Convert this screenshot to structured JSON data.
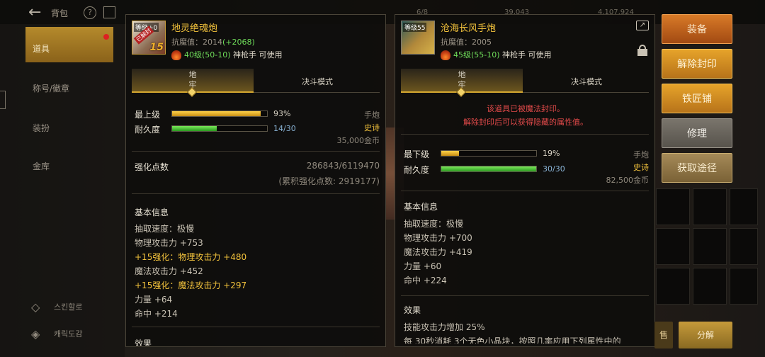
{
  "topbar": {
    "title": "背包",
    "help": "?",
    "nums": [
      "6/8",
      "39,043",
      "4,107,924"
    ]
  },
  "leftnav": {
    "items": [
      "道具",
      "称号/徽章",
      "装扮",
      "金库"
    ],
    "bottom": [
      "스킨할로",
      "캐릭도감"
    ]
  },
  "colors": {
    "gold": "#f2c23c",
    "green": "#6fdc5a",
    "red": "#e24a4a",
    "accent_orange": "#d87a28"
  },
  "panel1": {
    "icon_tag": "等级+0",
    "icon_seal": "已解封",
    "icon_level": "15",
    "name": "地灵绝魂炮",
    "resistance_label": "抗魔值：2014",
    "resistance_bonus": "(+2068)",
    "req_level": "40级(50-10)",
    "req_class": "神枪手 可使用",
    "tab_active": "地牢",
    "tab_inactive": "决斗模式",
    "stat1_label": "最上级",
    "stat1_value": "93%",
    "stat1_fill": 0.93,
    "stat2_label": "耐久度",
    "stat2_value": "14/30",
    "stat2_fill": 0.47,
    "weapon_type": "手炮",
    "rarity": "史诗",
    "price": "35,000金币",
    "reinforce_label": "强化点数",
    "reinforce_value": "286843/6119470",
    "reinforce_total": "(累积强化点数: 2919177)",
    "basic_info_title": "基本信息",
    "lines": [
      {
        "text": "抽取速度：极慢",
        "gold": false
      },
      {
        "text": "物理攻击力 +753",
        "gold": false
      },
      {
        "text": "+15强化：物理攻击力 +480",
        "gold": true
      },
      {
        "text": "魔法攻击力 +452",
        "gold": false
      },
      {
        "text": "+15强化：魔法攻击力 +297",
        "gold": true
      },
      {
        "text": "力量 +64",
        "gold": false
      },
      {
        "text": "命中 +214",
        "gold": false
      }
    ],
    "cut_title": "效果"
  },
  "panel2": {
    "icon_tag": "等级55",
    "name": "沧海长风手炮",
    "resistance_label": "抗魔值：2005",
    "req_level": "45级(55-10)",
    "req_class": "神枪手 可使用",
    "tab_active": "地牢",
    "tab_inactive": "决斗模式",
    "seal_notice_1": "该道具已被魔法封印。",
    "seal_notice_2": "解除封印后可以获得隐藏的属性值。",
    "stat1_label": "最下级",
    "stat1_value": "19%",
    "stat1_fill": 0.19,
    "stat2_label": "耐久度",
    "stat2_value": "30/30",
    "stat2_fill": 1.0,
    "weapon_type": "手炮",
    "rarity": "史诗",
    "price": "82,500金币",
    "basic_info_title": "基本信息",
    "lines": [
      "抽取速度：极慢",
      "物理攻击力 +700",
      "魔法攻击力 +419",
      "力量 +60",
      "命中 +224"
    ],
    "effect_title": "效果",
    "effect_line1": "技能攻击力增加 25%",
    "effect_line2": "每 30秒消耗 3个无色小晶块，按照几率应用下列属性中的"
  },
  "buttons": [
    "装备",
    "解除封印",
    "铁匠铺",
    "修理",
    "获取途径"
  ],
  "bottom_buttons": [
    "售",
    "分解"
  ]
}
